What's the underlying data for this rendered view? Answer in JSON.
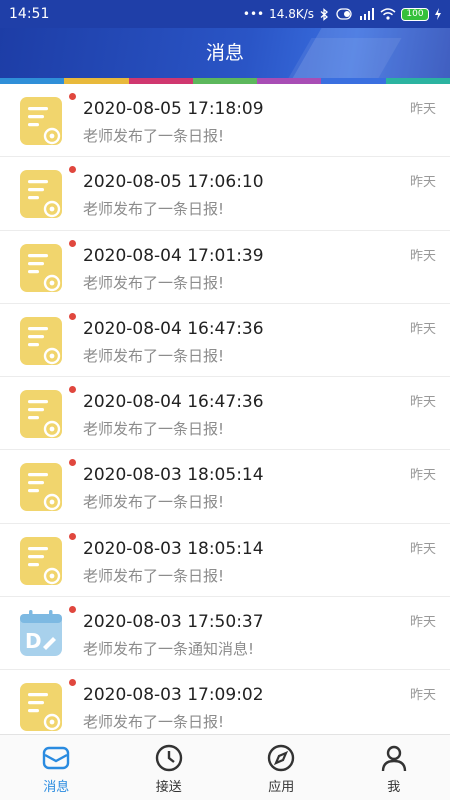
{
  "status_bar": {
    "time": "14:51",
    "network_speed": "14.8K/s",
    "battery": "100",
    "icons": [
      "bluetooth-icon",
      "vibrate-icon",
      "signal-icon",
      "wifi-icon",
      "battery-icon",
      "charging-icon"
    ]
  },
  "header": {
    "title": "消息",
    "strip_colors": [
      "#2f8fd8",
      "#e8b93b",
      "#d0376f",
      "#5cb85c",
      "#a84db5",
      "#3a6fe0",
      "#2bb3a0"
    ]
  },
  "messages": [
    {
      "time": "2020-08-05 17:18:09",
      "text": "老师发布了一条日报!",
      "when": "昨天",
      "type": "daily-report",
      "unread": true
    },
    {
      "time": "2020-08-05 17:06:10",
      "text": "老师发布了一条日报!",
      "when": "昨天",
      "type": "daily-report",
      "unread": true
    },
    {
      "time": "2020-08-04 17:01:39",
      "text": "老师发布了一条日报!",
      "when": "昨天",
      "type": "daily-report",
      "unread": true
    },
    {
      "time": "2020-08-04 16:47:36",
      "text": "老师发布了一条日报!",
      "when": "昨天",
      "type": "daily-report",
      "unread": true
    },
    {
      "time": "2020-08-04 16:47:36",
      "text": "老师发布了一条日报!",
      "when": "昨天",
      "type": "daily-report",
      "unread": true
    },
    {
      "time": "2020-08-03 18:05:14",
      "text": "老师发布了一条日报!",
      "when": "昨天",
      "type": "daily-report",
      "unread": true
    },
    {
      "time": "2020-08-03 18:05:14",
      "text": "老师发布了一条日报!",
      "when": "昨天",
      "type": "daily-report",
      "unread": true
    },
    {
      "time": "2020-08-03 17:50:37",
      "text": "老师发布了一条通知消息!",
      "when": "昨天",
      "type": "notice",
      "unread": true
    },
    {
      "time": "2020-08-03 17:09:02",
      "text": "老师发布了一条日报!",
      "when": "昨天",
      "type": "daily-report",
      "unread": true
    }
  ],
  "tabbar": {
    "tabs": [
      {
        "label": "消息",
        "icon": "mail-icon",
        "active": true
      },
      {
        "label": "接送",
        "icon": "clock-icon",
        "active": false
      },
      {
        "label": "应用",
        "icon": "compass-icon",
        "active": false
      },
      {
        "label": "我",
        "icon": "person-icon",
        "active": false
      }
    ],
    "active_color": "#2a8be0"
  }
}
